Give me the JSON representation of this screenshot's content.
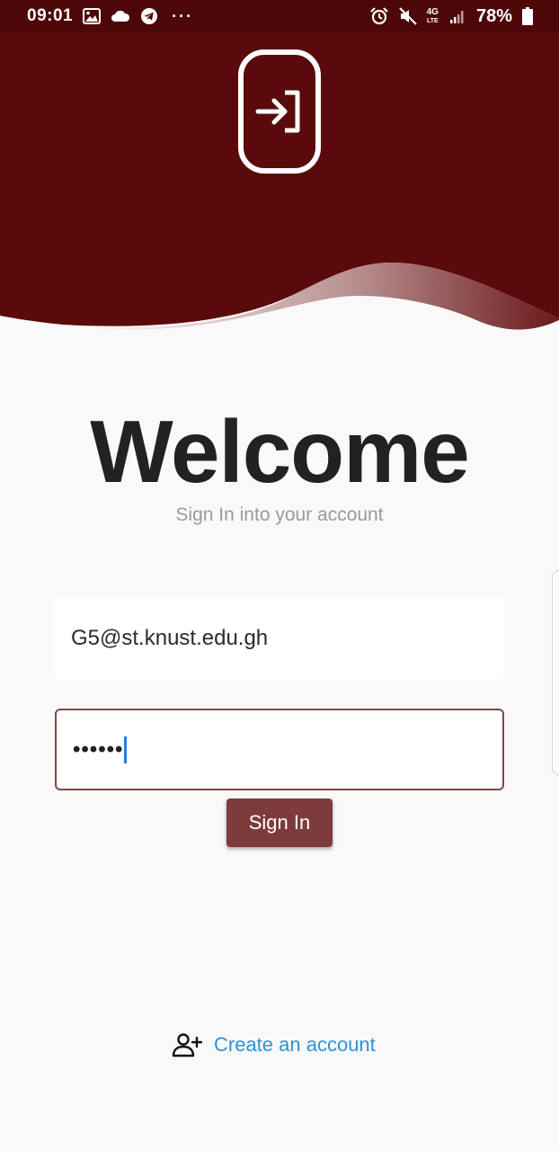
{
  "status_bar": {
    "time": "09:01",
    "network": "4G",
    "network_sub": "LTE",
    "battery": "78%",
    "icons": [
      "gallery-icon",
      "cloud-icon",
      "telegram-icon",
      "more-dots-icon",
      "alarm-icon",
      "mute-icon",
      "signal-icon",
      "battery-icon"
    ]
  },
  "header": {
    "logo_icon": "login-icon",
    "color": "#5b0a0b"
  },
  "welcome": {
    "title": "Welcome",
    "subtitle": "Sign In into your account"
  },
  "form": {
    "email_value": "G5@st.knust.edu.gh",
    "password_masked": "••••••",
    "signin_label": "Sign In"
  },
  "footer": {
    "create_account_label": "Create an account",
    "create_account_icon": "person-add-icon"
  },
  "colors": {
    "header": "#5b0a0b",
    "button": "#7d3b3b",
    "link": "#2d93d7"
  }
}
